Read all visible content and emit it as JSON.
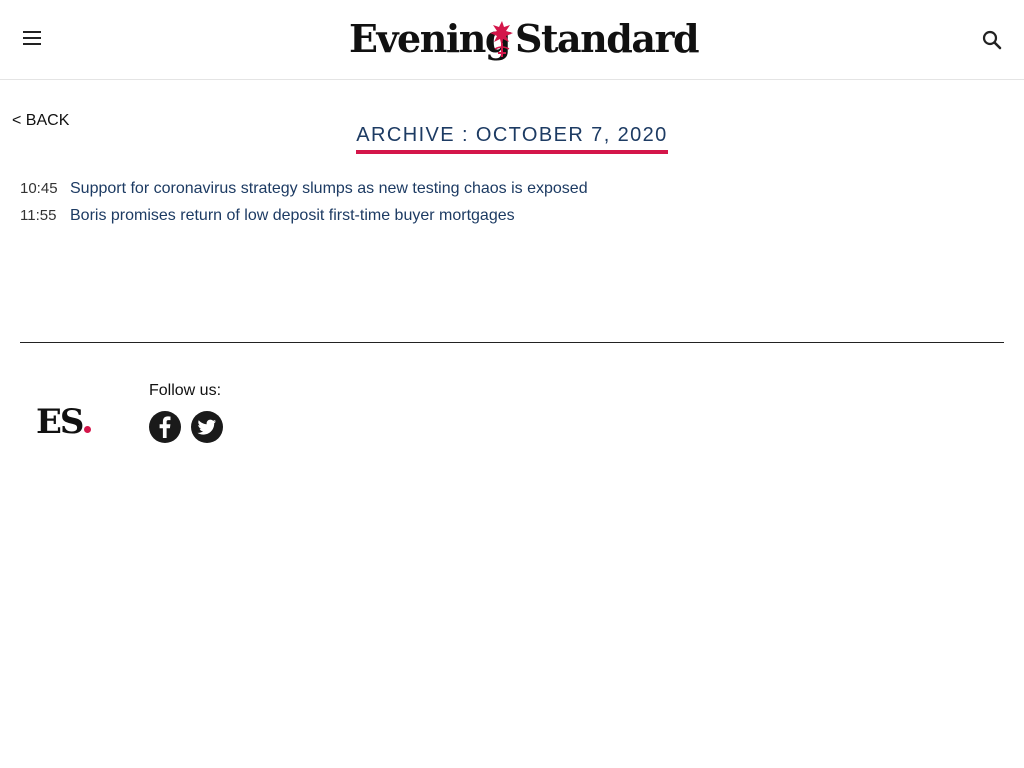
{
  "header": {
    "menu_icon": "hamburger-menu-icon",
    "search_icon": "search-icon",
    "logo": {
      "left_word": "Evening",
      "right_word": "Standard",
      "crest_icon": "griffin-crest-icon",
      "crest_color": "#d4164a"
    }
  },
  "nav": {
    "back_label": "< BACK"
  },
  "archive": {
    "title": "ARCHIVE : OCTOBER 7, 2020",
    "accent_color": "#d4164a",
    "title_color": "#1d3b63"
  },
  "articles": [
    {
      "time": "10:45",
      "headline": "Support for coronavirus strategy slumps as new testing chaos is exposed"
    },
    {
      "time": "11:55",
      "headline": "Boris promises return of low deposit first-time buyer mortgages"
    }
  ],
  "footer": {
    "logo_text": "ES",
    "logo_dot_color": "#d4164a",
    "follow_label": "Follow us:",
    "social": [
      {
        "name": "Facebook",
        "icon": "facebook-icon"
      },
      {
        "name": "Twitter",
        "icon": "twitter-icon"
      }
    ]
  }
}
